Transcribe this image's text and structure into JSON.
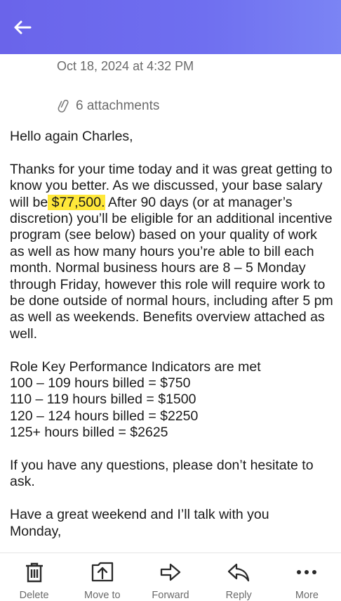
{
  "header": {
    "back_icon": "arrow-left-icon",
    "color_start": "#6a64ea",
    "color_end": "#7b84f4"
  },
  "message": {
    "date": "Oct 18, 2024 at 4:32 PM",
    "attachments_label": "6 attachments",
    "greeting": "Hello again Charles,",
    "para1_before": "Thanks for your time today and it was great getting to know you better. As we discussed, your base salary will be",
    "para1_highlight": " $77,500.",
    "para1_after": " After 90 days (or at manager’s discretion) you’ll be eligible for an additional incentive program (see below) based on your quality of work as well as how many hours you’re able to bill each month. Normal business hours are 8 – 5 Monday through Friday, however this role will require work to be done outside of normal hours, including after 5 pm as well as weekends.  Benefits overview attached as well.",
    "kpi_heading": "Role Key Performance Indicators are met",
    "kpi_lines": [
      "100 – 109 hours billed = $750",
      "110 – 119 hours billed = $1500",
      "120 – 124 hours billed = $2250",
      "125+ hours billed = $2625"
    ],
    "questions": "If you have any questions, please don’t hesitate to ask.",
    "closing_line1": "Have a great weekend and I’ll talk with you",
    "closing_line2": "Monday,"
  },
  "toolbar": {
    "items": [
      {
        "label": "Delete",
        "icon": "trash-icon"
      },
      {
        "label": "Move to",
        "icon": "move-to-icon"
      },
      {
        "label": "Forward",
        "icon": "forward-icon"
      },
      {
        "label": "Reply",
        "icon": "reply-icon"
      },
      {
        "label": "More",
        "icon": "more-icon"
      }
    ]
  }
}
